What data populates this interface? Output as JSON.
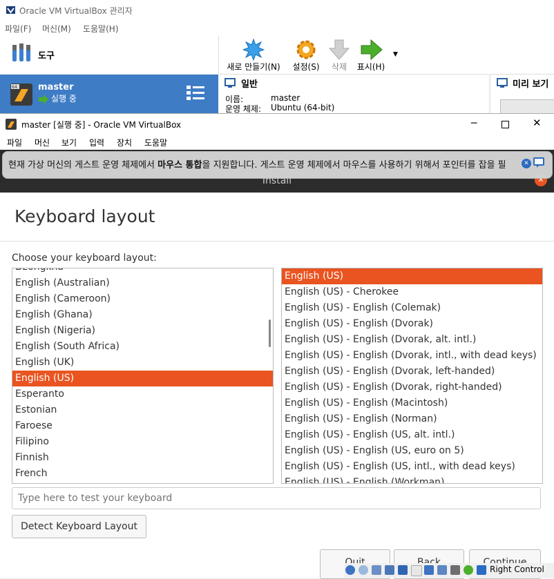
{
  "manager": {
    "title": "Oracle VM VirtualBox 관리자",
    "menu": [
      "파일(F)",
      "머신(M)",
      "도움말(H)"
    ],
    "tools_label": "도구",
    "vm_name": "master",
    "vm_state": "실행 중",
    "toolbar": {
      "new": "새로 만들기(N)",
      "settings": "설정(S)",
      "remove": "삭제",
      "show": "표시(H)"
    },
    "general": {
      "heading": "일반",
      "name_label": "이름:",
      "name_value": "master",
      "os_label": "운영 체제:",
      "os_value": "Ubuntu (64-bit)"
    },
    "preview_heading": "미리 보기"
  },
  "vm_window": {
    "title": "master [실행 중] - Oracle VM VirtualBox",
    "menu": [
      "파일",
      "머신",
      "보기",
      "입력",
      "장치",
      "도움말"
    ],
    "status_text": "Right Control"
  },
  "notification": {
    "text_before": "현재 가상 머신의 게스트 운영 체제에서 ",
    "text_bold": "마우스 통합",
    "text_after": "을 지원합니다. 게스트 운영 체제에서 마우스를 사용하기 위해서 포인터를 잡을 필"
  },
  "installer": {
    "topbar_title": "Install",
    "heading": "Keyboard layout",
    "choose_label": "Choose your keyboard layout:",
    "layouts": [
      "Dzongkha",
      "English (Australian)",
      "English (Cameroon)",
      "English (Ghana)",
      "English (Nigeria)",
      "English (South Africa)",
      "English (UK)",
      "English (US)",
      "Esperanto",
      "Estonian",
      "Faroese",
      "Filipino",
      "Finnish",
      "French"
    ],
    "layouts_selected": "English (US)",
    "variants": [
      "English (US)",
      "English (US) - Cherokee",
      "English (US) - English (Colemak)",
      "English (US) - English (Dvorak)",
      "English (US) - English (Dvorak, alt. intl.)",
      "English (US) - English (Dvorak, intl., with dead keys)",
      "English (US) - English (Dvorak, left-handed)",
      "English (US) - English (Dvorak, right-handed)",
      "English (US) - English (Macintosh)",
      "English (US) - English (Norman)",
      "English (US) - English (US, alt. intl.)",
      "English (US) - English (US, euro on 5)",
      "English (US) - English (US, intl., with dead keys)",
      "English (US) - English (Workman)"
    ],
    "variants_selected": "English (US)",
    "test_placeholder": "Type here to test your keyboard",
    "detect_button": "Detect Keyboard Layout",
    "quit_button": "Quit",
    "back_button": "Back",
    "continue_button": "Continue"
  },
  "colors": {
    "accent": "#e95420",
    "manager_selection": "#3e7cc5"
  }
}
